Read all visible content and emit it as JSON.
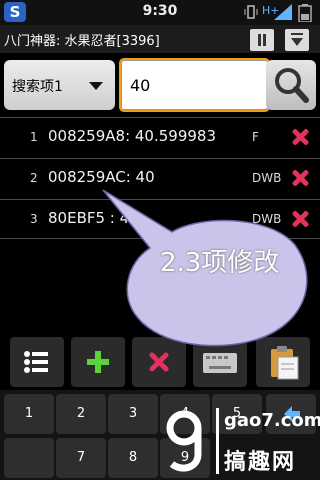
{
  "status_bar": {
    "app_icon_glyph": "S",
    "time": "9:30",
    "network_label": "H+"
  },
  "title_bar": {
    "title": "八门神器: 水果忍者[3396]"
  },
  "search": {
    "type_label": "搜索项1",
    "value": "40"
  },
  "results": [
    {
      "index": "1",
      "text": "008259A8: 40.599983",
      "type": "F"
    },
    {
      "index": "2",
      "text": "008259AC: 40",
      "type": "DWB"
    },
    {
      "index": "3",
      "text": "80EBF5  : 40",
      "type": "DWB"
    }
  ],
  "annotation": {
    "text": "2.3项修改"
  },
  "keypad": {
    "row1": [
      "1",
      "2",
      "3",
      "4",
      "5"
    ],
    "row2": [
      "7",
      "8",
      "9"
    ]
  },
  "watermark": {
    "domain": "gao7.com",
    "brand": "搞趣网"
  },
  "colors": {
    "accent_red": "#e3325b",
    "accent_green": "#5ad43a",
    "bubble": "#c9c4e9",
    "focus_ring": "#f39c12"
  }
}
